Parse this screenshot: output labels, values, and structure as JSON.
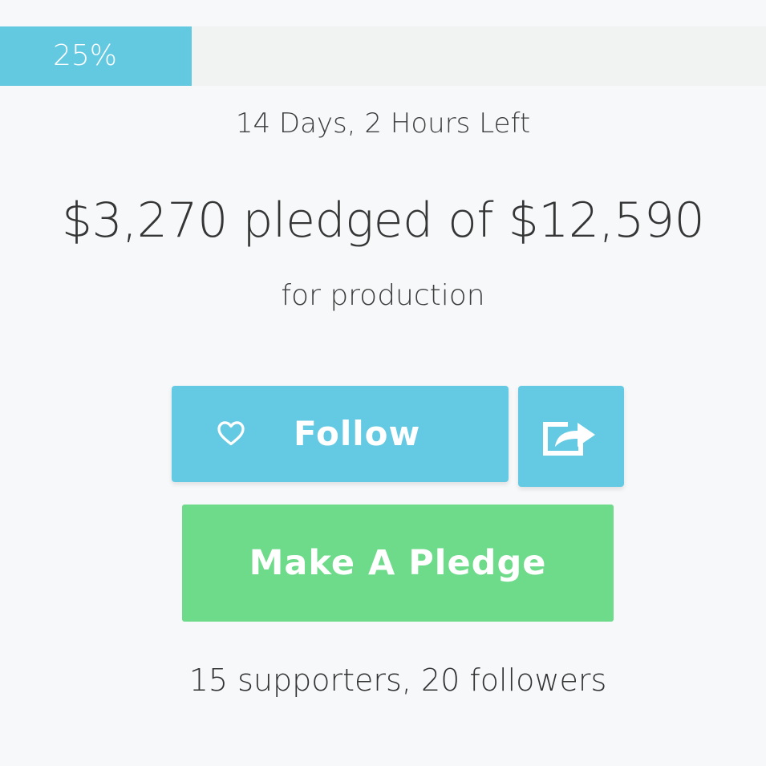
{
  "campaign": {
    "progress_label": "25%",
    "progress_fraction": 0.25,
    "time_left": "14 Days, 2 Hours Left",
    "pledged_summary": "$3,270 pledged of $12,590",
    "purpose": "for production",
    "stats": "15 supporters, 20 followers"
  },
  "actions": {
    "follow_label": "Follow",
    "follow_icon": "heart-outline-icon",
    "share_icon": "share-icon",
    "pledge_label": "Make A Pledge"
  },
  "colors": {
    "accent_blue": "#64c9e2",
    "accent_green": "#6edb8b",
    "background": "#f6f8fa"
  }
}
